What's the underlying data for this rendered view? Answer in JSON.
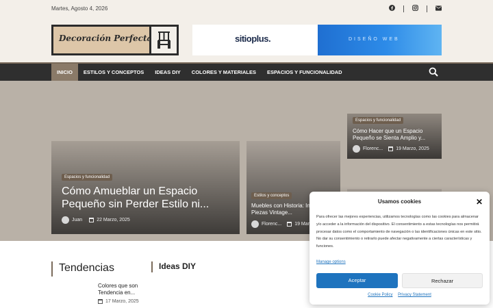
{
  "topbar": {
    "date": "Martes, Agosto 4, 2026",
    "social_icons": [
      "facebook-icon",
      "instagram-icon",
      "email-icon"
    ]
  },
  "header": {
    "logo_text": "Decoración Perfecta",
    "banner_brand": "sitioplus.",
    "banner_tagline": "DISEÑO WEB"
  },
  "nav": {
    "items": [
      {
        "label": "INICIO",
        "active": true
      },
      {
        "label": "ESTILOS Y CONCEPTOS"
      },
      {
        "label": "IDEAS DIY"
      },
      {
        "label": "COLORES Y MATERIALES"
      },
      {
        "label": "ESPACIOS Y FUNCIONALIDAD"
      }
    ]
  },
  "hero": {
    "main": {
      "category": "Espacios y funcionalidad",
      "title": "Cómo Amueblar un Espacio Pequeño sin Perder Estilo ni...",
      "author": "Juan",
      "date": "22 Marzo, 2025"
    },
    "mid": {
      "category": "Estilos y conceptos",
      "title": "Muebles con Historia: Integrar Piezas Vintage...",
      "author": "Florenc...",
      "date": "19 Marzo, 2025"
    },
    "top_right": {
      "category": "Espacios y funcionalidad",
      "title": "Cómo Hacer que un Espacio Pequeño se Sienta Amplio y...",
      "author": "Florenc...",
      "date": "19 Marzo, 2025"
    }
  },
  "sections": {
    "tendencias": {
      "title": "Tendencias",
      "item_title": "Colores que son Tendencia en...",
      "item_date": "17 Marzo, 2025"
    },
    "ideas_diy": {
      "title": "Ideas DIY"
    }
  },
  "cookie": {
    "title": "Usamos cookies",
    "body": "Para ofrecer las mejores experiencias, utilizamos tecnologías como las cookies para almacenar y/o acceder a la información del dispositivo. El consentimiento a estas tecnologías nos permitirá procesar datos como el comportamiento de navegación o las identificaciones únicas en este sitio. No dar su consentimiento o retirarlo puede afectar negativamente a ciertas características y funciones.",
    "manage": "Manage options",
    "accept": "Aceptar",
    "reject": "Rechazar",
    "cookie_policy": "Cookie Policy",
    "privacy": "Privacy Statement"
  },
  "colors": {
    "accent_brown": "#7a6a5a",
    "nav_bg": "#2f2f2f",
    "button_blue": "#1e73be"
  }
}
